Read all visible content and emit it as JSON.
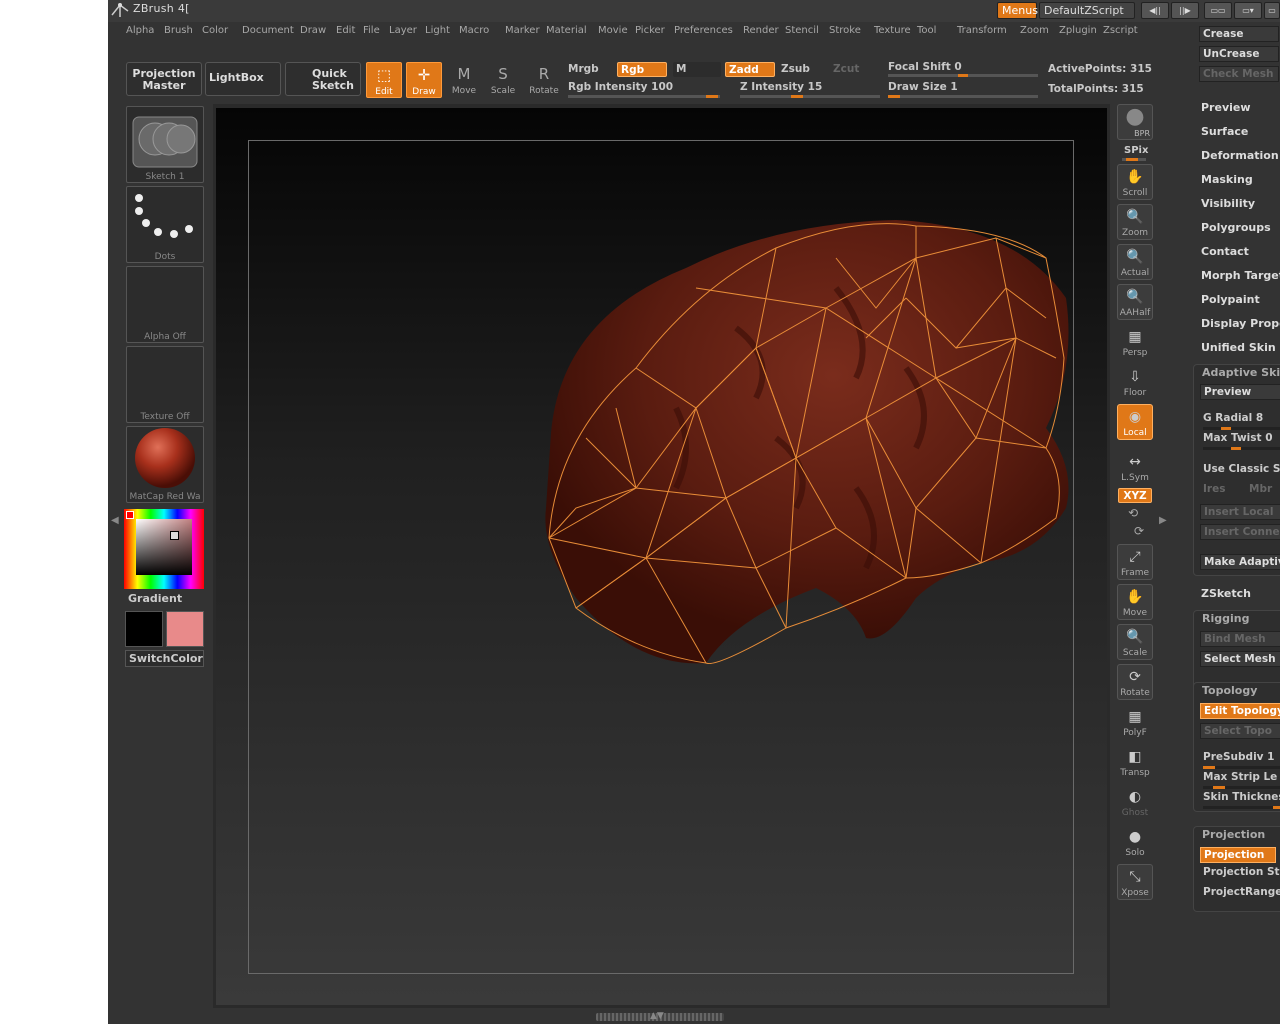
{
  "app": {
    "title": "ZBrush 4[",
    "menus_button": "Menus",
    "script_button": "DefaultZScript"
  },
  "menubar": [
    "Alpha",
    "Brush",
    "Color",
    "Document",
    "Draw",
    "Edit",
    "File",
    "Layer",
    "Light",
    "Macro",
    "Marker",
    "Material",
    "Movie",
    "Picker",
    "Preferences",
    "Render",
    "Stencil",
    "Stroke",
    "Texture",
    "Tool",
    "Transform",
    "Zoom",
    "Zplugin",
    "Zscript"
  ],
  "toolbar": {
    "projection_master": "Projection Master",
    "lightbox": "LightBox",
    "quick_sketch": "Quick Sketch",
    "edit": "Edit",
    "draw": "Draw",
    "move": "Move",
    "scale": "Scale",
    "rotate": "Rotate",
    "mrgb": "Mrgb",
    "rgb": "Rgb",
    "m": "M",
    "rgb_intensity_label": "Rgb Intensity 100",
    "zadd": "Zadd",
    "zsub": "Zsub",
    "zcut": "Zcut",
    "z_intensity_label": "Z Intensity 15",
    "focal_shift_label": "Focal Shift 0",
    "draw_size_label": "Draw Size 1",
    "active_points": "ActivePoints: 315",
    "total_points": "TotalPoints: 315",
    "rgb_intensity_value": 100,
    "z_intensity_value": 15,
    "focal_shift_value": 0,
    "draw_size_value": 1
  },
  "left_shelf": {
    "sketch_label": "Sketch 1",
    "dots_label": "Dots",
    "alpha_label": "Alpha Off",
    "texture_label": "Texture Off",
    "material_label": "MatCap Red Wa",
    "gradient_label": "Gradient",
    "switchcolor_label": "SwitchColor",
    "primary_color": "#000000",
    "secondary_color": "#e88a8a"
  },
  "right_shelf": {
    "bpr": "BPR",
    "spix": "SPix",
    "scroll": "Scroll",
    "zoom": "Zoom",
    "actual": "Actual",
    "aahalf": "AAHalf",
    "persp": "Persp",
    "floor": "Floor",
    "local": "Local",
    "lsym": "L.Sym",
    "xyz": "XYZ",
    "frame": "Frame",
    "move": "Move",
    "scale": "Scale",
    "rotate": "Rotate",
    "polyf": "PolyF",
    "transp": "Transp",
    "ghost": "Ghost",
    "solo": "Solo",
    "xpose": "Xpose"
  },
  "right_panel": {
    "crease": "Crease",
    "uncrease": "UnCrease",
    "check_mesh": "Check Mesh",
    "sections": [
      "Preview",
      "Surface",
      "Deformation",
      "Masking",
      "Visibility",
      "Polygroups",
      "Contact",
      "Morph Target",
      "Polypaint",
      "Display Prope",
      "Unified Skin"
    ],
    "adaptive_skin": {
      "title": "Adaptive Skin",
      "preview": "Preview",
      "g_radial": "G Radial 8",
      "max_twist": "Max Twist 0",
      "use_classic": "Use Classic S",
      "ires": "Ires",
      "mbr": "Mbr",
      "insert_local": "Insert Local",
      "insert_conne": "Insert Conne",
      "make_adaptive": "Make Adaptiv"
    },
    "zsketch": "ZSketch",
    "rigging": {
      "title": "Rigging",
      "bind_mesh": "Bind Mesh",
      "select_mesh": "Select Mesh"
    },
    "topology": {
      "title": "Topology",
      "edit_topology": "Edit Topology",
      "select_topo": "Select Topo",
      "presubdiv": "PreSubdiv 1",
      "max_strip": "Max Strip Le",
      "skin_thickness": "Skin Thicknes"
    },
    "projection": {
      "title": "Projection",
      "projection": "Projection",
      "projection_st": "Projection St",
      "project_range": "ProjectRange"
    }
  },
  "colors": {
    "accent": "#e07818",
    "panel": "#333333",
    "mesh": "#5a1e12",
    "wire": "#f0923a"
  }
}
